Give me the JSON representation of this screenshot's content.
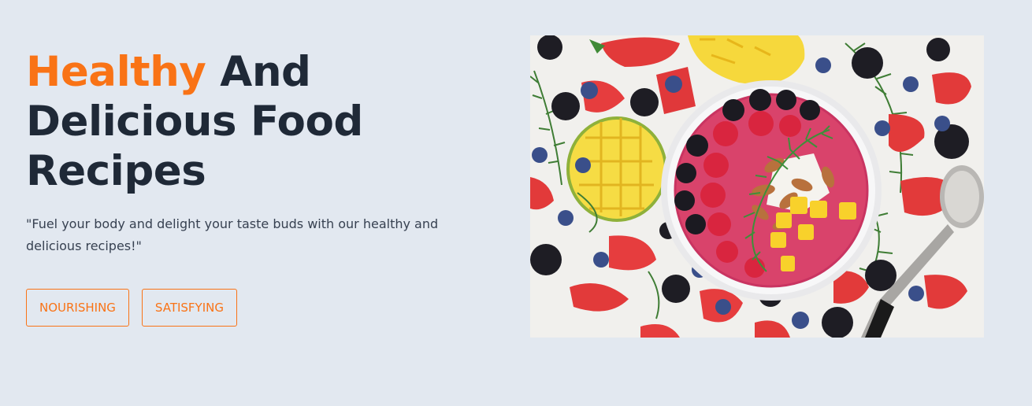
{
  "hero": {
    "title_accent": "Healthy",
    "title_rest_line1": " And",
    "title_line2": "Delicious Food",
    "title_line3": "Recipes",
    "tagline": "\"Fuel your body and delight your taste buds with our healthy and delicious recipes!\""
  },
  "tags": [
    {
      "label": "NOURISHING"
    },
    {
      "label": "SATISFYING"
    }
  ],
  "image": {
    "subject": "smoothie-bowl-with-fruits"
  },
  "colors": {
    "background": "#e2e8f0",
    "accent": "#f97316",
    "heading": "#1f2937",
    "body_text": "#374151"
  }
}
